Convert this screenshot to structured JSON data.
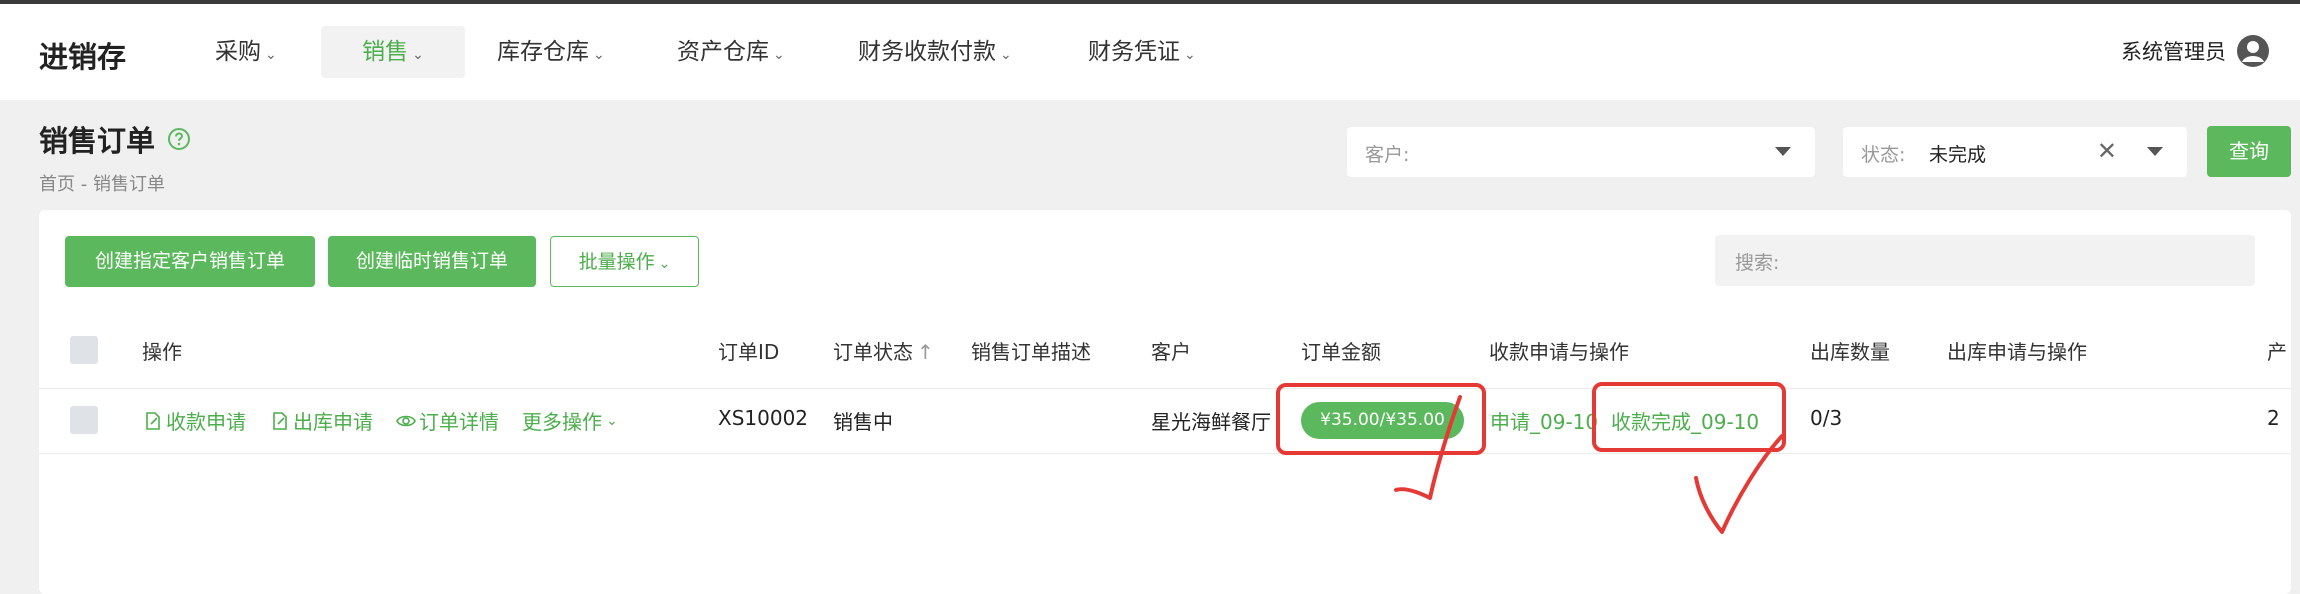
{
  "nav": {
    "brand": "进销存",
    "items": [
      {
        "label": "采购"
      },
      {
        "label": "销售"
      },
      {
        "label": "库存仓库"
      },
      {
        "label": "资产仓库"
      },
      {
        "label": "财务收款付款"
      },
      {
        "label": "财务凭证"
      }
    ],
    "user": "系统管理员"
  },
  "page": {
    "title": "销售订单",
    "breadcrumb": "首页 - 销售订单"
  },
  "filters": {
    "customer_label": "客户:",
    "status_label": "状态:",
    "status_value": "未完成",
    "query_label": "查询"
  },
  "toolbar": {
    "create_customer_order": "创建指定客户销售订单",
    "create_temp_order": "创建临时销售订单",
    "batch_ops": "批量操作",
    "search_placeholder": "搜索:"
  },
  "table": {
    "headers": [
      "操作",
      "订单ID",
      "订单状态",
      "销售订单描述",
      "客户",
      "订单金额",
      "收款申请与操作",
      "出库数量",
      "出库申请与操作",
      "产"
    ],
    "rows": [
      {
        "ops": [
          "收款申请",
          "出库申请",
          "订单详情",
          "更多操作"
        ],
        "order_id": "XS10002",
        "status": "销售中",
        "description": "",
        "customer": "星光海鲜餐厅",
        "amount": "¥35.00/¥35.00",
        "payment_apply": "申请_09-10",
        "payment_done": "收款完成_09-10",
        "outbound_qty": "0/3",
        "outbound_ops": "",
        "product": "2"
      }
    ]
  },
  "colors": {
    "accent": "#5cb85c",
    "annotation": "#e53935"
  }
}
